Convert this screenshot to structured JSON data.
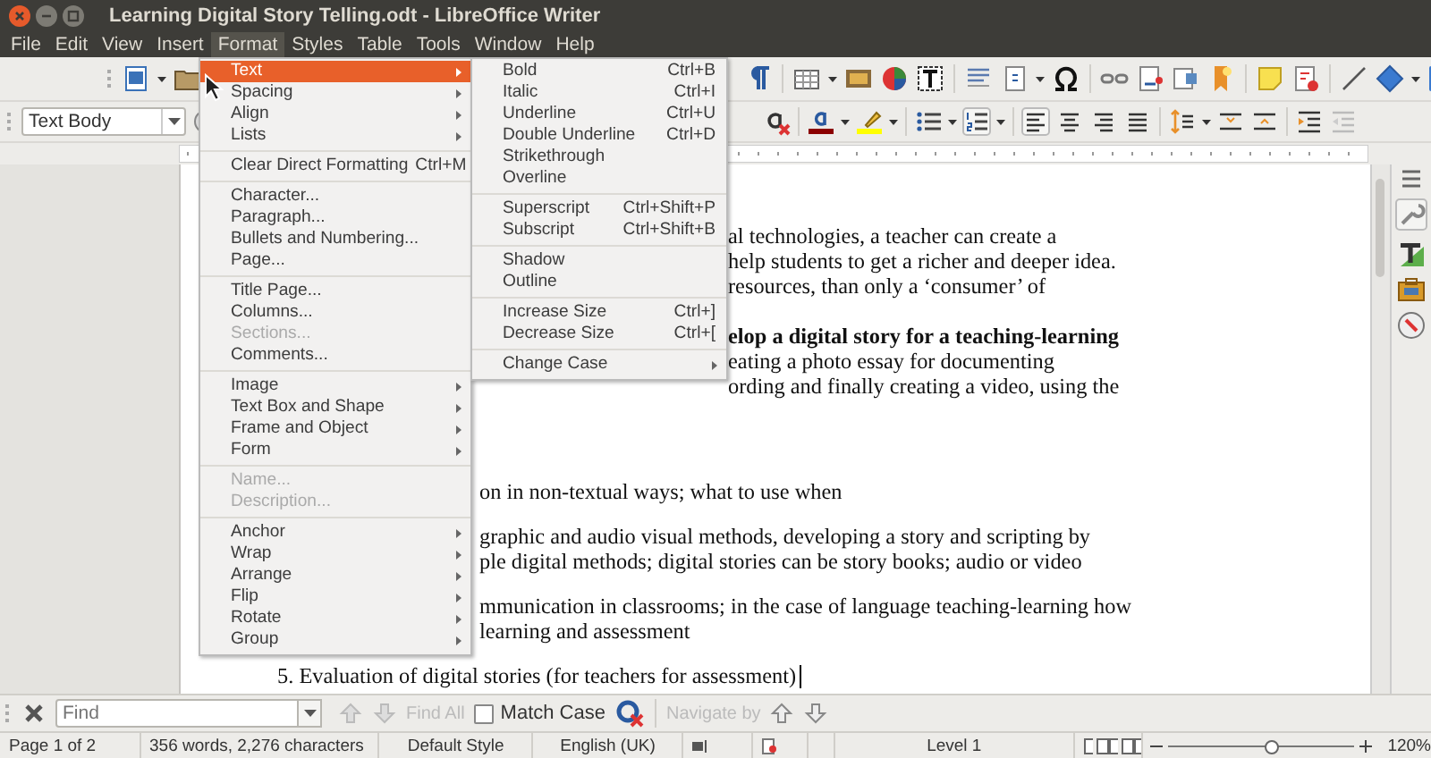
{
  "window": {
    "title": "Learning Digital Story Telling.odt - LibreOffice Writer"
  },
  "menu_bar": [
    {
      "label": "File",
      "selected": false
    },
    {
      "label": "Edit",
      "selected": false
    },
    {
      "label": "View",
      "selected": false
    },
    {
      "label": "Insert",
      "selected": false
    },
    {
      "label": "Format",
      "selected": true
    },
    {
      "label": "Styles",
      "selected": false
    },
    {
      "label": "Table",
      "selected": false
    },
    {
      "label": "Tools",
      "selected": false
    },
    {
      "label": "Window",
      "selected": false
    },
    {
      "label": "Help",
      "selected": false
    }
  ],
  "paragraph_style": {
    "value": "Text Body"
  },
  "document": {
    "paragraphs": [
      {
        "lines": [
          {
            "text": "al technologies, a teacher can create a",
            "kind": "behind_submenu",
            "bold": false
          },
          {
            "text": "help students to get a richer and deeper idea.",
            "kind": "behind_submenu",
            "bold": false
          },
          {
            "text": "resources, than only a ‘consumer’ of",
            "kind": "behind_submenu",
            "bold": false
          }
        ]
      },
      {
        "lines": [
          {
            "text": "elop a digital story for a teaching-learning",
            "kind": "behind_submenu",
            "bold": true
          },
          {
            "text": "eating a photo essay for documenting",
            "kind": "behind_submenu",
            "bold": false
          },
          {
            "text": "ording and finally creating a video, using the",
            "kind": "behind_submenu",
            "bold": false
          }
        ]
      },
      {
        "lines": [
          {
            "text": "on in non-textual ways; what to use when",
            "kind": "behind_menu",
            "bold": false
          }
        ]
      },
      {
        "lines": [
          {
            "text": "graphic and audio visual methods, developing a story and scripting by",
            "kind": "behind_menu",
            "bold": false
          },
          {
            "text": "ple digital methods; digital stories can be story books; audio or video",
            "kind": "behind_menu",
            "bold": false
          }
        ]
      },
      {
        "lines": [
          {
            "text": "mmunication in classrooms; in the case of language teaching-learning how",
            "kind": "behind_menu",
            "bold": false
          },
          {
            "text": "learning and assessment",
            "kind": "behind_menu",
            "bold": false
          }
        ]
      },
      {
        "lines": [
          {
            "text": "5.   Evaluation of digital stories  (for teachers for assessment)",
            "kind": "full",
            "bold": false
          }
        ]
      }
    ]
  },
  "format_menu": {
    "items": [
      {
        "kind": "item",
        "label": "Text",
        "submenu": true,
        "selected": true,
        "disabled": false
      },
      {
        "kind": "item",
        "label": "Spacing",
        "submenu": true,
        "selected": false,
        "disabled": false
      },
      {
        "kind": "item",
        "label": "Align",
        "submenu": true,
        "selected": false,
        "disabled": false
      },
      {
        "kind": "item",
        "label": "Lists",
        "submenu": true,
        "selected": false,
        "disabled": false
      },
      {
        "kind": "separator"
      },
      {
        "kind": "item",
        "label": "Clear Direct Formatting",
        "shortcut": "Ctrl+M",
        "submenu": false,
        "selected": false,
        "disabled": false
      },
      {
        "kind": "separator"
      },
      {
        "kind": "item",
        "label": "Character...",
        "submenu": false,
        "selected": false,
        "disabled": false
      },
      {
        "kind": "item",
        "label": "Paragraph...",
        "submenu": false,
        "selected": false,
        "disabled": false
      },
      {
        "kind": "item",
        "label": "Bullets and Numbering...",
        "submenu": false,
        "selected": false,
        "disabled": false
      },
      {
        "kind": "item",
        "label": "Page...",
        "submenu": false,
        "selected": false,
        "disabled": false
      },
      {
        "kind": "separator"
      },
      {
        "kind": "item",
        "label": "Title Page...",
        "submenu": false,
        "selected": false,
        "disabled": false
      },
      {
        "kind": "item",
        "label": "Columns...",
        "submenu": false,
        "selected": false,
        "disabled": false
      },
      {
        "kind": "item",
        "label": "Sections...",
        "submenu": false,
        "selected": false,
        "disabled": true
      },
      {
        "kind": "item",
        "label": "Comments...",
        "submenu": false,
        "selected": false,
        "disabled": false
      },
      {
        "kind": "separator"
      },
      {
        "kind": "item",
        "label": "Image",
        "submenu": true,
        "selected": false,
        "disabled": false
      },
      {
        "kind": "item",
        "label": "Text Box and Shape",
        "submenu": true,
        "selected": false,
        "disabled": false
      },
      {
        "kind": "item",
        "label": "Frame and Object",
        "submenu": true,
        "selected": false,
        "disabled": false
      },
      {
        "kind": "item",
        "label": "Form",
        "submenu": true,
        "selected": false,
        "disabled": false
      },
      {
        "kind": "separator"
      },
      {
        "kind": "item",
        "label": "Name...",
        "submenu": false,
        "selected": false,
        "disabled": true
      },
      {
        "kind": "item",
        "label": "Description...",
        "submenu": false,
        "selected": false,
        "disabled": true
      },
      {
        "kind": "separator"
      },
      {
        "kind": "item",
        "label": "Anchor",
        "submenu": true,
        "selected": false,
        "disabled": false
      },
      {
        "kind": "item",
        "label": "Wrap",
        "submenu": true,
        "selected": false,
        "disabled": false
      },
      {
        "kind": "item",
        "label": "Arrange",
        "submenu": true,
        "selected": false,
        "disabled": false
      },
      {
        "kind": "item",
        "label": "Flip",
        "submenu": true,
        "selected": false,
        "disabled": false
      },
      {
        "kind": "item",
        "label": "Rotate",
        "submenu": true,
        "selected": false,
        "disabled": false
      },
      {
        "kind": "item",
        "label": "Group",
        "submenu": true,
        "selected": false,
        "disabled": false
      }
    ]
  },
  "text_submenu": {
    "items": [
      {
        "kind": "item",
        "label": "Bold",
        "shortcut": "Ctrl+B",
        "submenu": false
      },
      {
        "kind": "item",
        "label": "Italic",
        "shortcut": "Ctrl+I",
        "submenu": false
      },
      {
        "kind": "item",
        "label": "Underline",
        "shortcut": "Ctrl+U",
        "submenu": false
      },
      {
        "kind": "item",
        "label": "Double Underline",
        "shortcut": "Ctrl+D",
        "submenu": false
      },
      {
        "kind": "item",
        "label": "Strikethrough",
        "submenu": false
      },
      {
        "kind": "item",
        "label": "Overline",
        "submenu": false
      },
      {
        "kind": "separator"
      },
      {
        "kind": "item",
        "label": "Superscript",
        "shortcut": "Ctrl+Shift+P",
        "submenu": false
      },
      {
        "kind": "item",
        "label": "Subscript",
        "shortcut": "Ctrl+Shift+B",
        "submenu": false
      },
      {
        "kind": "separator"
      },
      {
        "kind": "item",
        "label": "Shadow",
        "submenu": false
      },
      {
        "kind": "item",
        "label": "Outline",
        "submenu": false
      },
      {
        "kind": "separator"
      },
      {
        "kind": "item",
        "label": "Increase Size",
        "shortcut": "Ctrl+]",
        "submenu": false
      },
      {
        "kind": "item",
        "label": "Decrease Size",
        "shortcut": "Ctrl+[",
        "submenu": false
      },
      {
        "kind": "separator"
      },
      {
        "kind": "item",
        "label": "Change Case",
        "submenu": true
      }
    ]
  },
  "find_bar": {
    "placeholder": "Find",
    "find_all": {
      "label": "Find All",
      "disabled": true
    },
    "match_case": {
      "label": "Match Case",
      "checked": false
    },
    "navigate_by": {
      "label": "Navigate by",
      "disabled": true
    }
  },
  "status_bar": {
    "page": "Page 1 of 2",
    "words": "356 words, 2,276 characters",
    "page_style": "Default Style",
    "language": "English (UK)",
    "outline_level": "Level 1",
    "zoom": {
      "level": 0.55
    },
    "zoom_value": "120%"
  }
}
